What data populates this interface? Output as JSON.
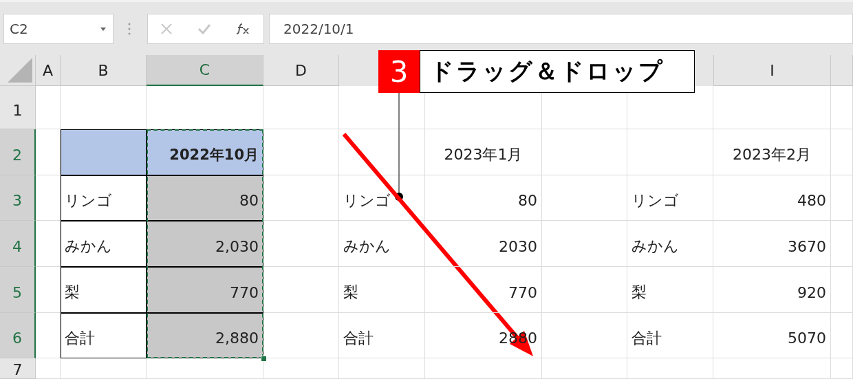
{
  "name_box": {
    "value": "C2"
  },
  "formula_bar": {
    "value": "2022/10/1"
  },
  "columns": [
    {
      "label": "A",
      "selected": false
    },
    {
      "label": "B",
      "selected": false
    },
    {
      "label": "C",
      "selected": true
    },
    {
      "label": "D",
      "selected": false
    },
    {},
    {},
    {},
    {},
    {
      "label": "I",
      "selected": false
    },
    {
      "selected": false
    }
  ],
  "rows": [
    {
      "label": "1",
      "selected": false
    },
    {
      "label": "2",
      "selected": true
    },
    {
      "label": "3",
      "selected": true
    },
    {
      "label": "4",
      "selected": true
    },
    {
      "label": "5",
      "selected": true
    },
    {
      "label": "6",
      "selected": true
    },
    {
      "label": "7",
      "selected": false
    }
  ],
  "tables": [
    {
      "kind": "bordered",
      "copy_range": true,
      "heading": "2022年10月",
      "rows": [
        {
          "label": "リンゴ",
          "value": "80"
        },
        {
          "label": "みかん",
          "value": "2,030"
        },
        {
          "label": "梨",
          "value": "770"
        },
        {
          "label": "合計",
          "value": "2,880"
        }
      ]
    },
    {
      "kind": "plain",
      "copy_range": false,
      "heading": "2023年1月",
      "rows": [
        {
          "label": "リンゴ",
          "value": "80"
        },
        {
          "label": "みかん",
          "value": "2030"
        },
        {
          "label": "梨",
          "value": "770"
        },
        {
          "label": "合計",
          "value": "2880"
        }
      ]
    },
    {
      "kind": "plain",
      "copy_range": false,
      "heading": "2023年2月",
      "rows": [
        {
          "label": "リンゴ",
          "value": "480"
        },
        {
          "label": "みかん",
          "value": "3670"
        },
        {
          "label": "梨",
          "value": "920"
        },
        {
          "label": "合計",
          "value": "5070"
        }
      ]
    }
  ],
  "annotation": {
    "step": "3",
    "text": "ドラッグ＆ドロップ"
  }
}
